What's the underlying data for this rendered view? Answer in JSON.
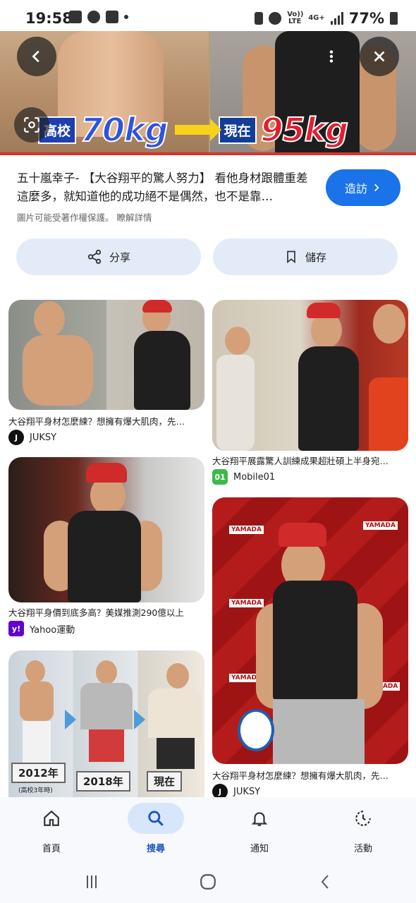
{
  "status_bar": {
    "time": "19:58",
    "volte": "Vo)) LTE",
    "network": "4G+",
    "battery": "77%"
  },
  "hero": {
    "label_left": "高校",
    "value_left": "70kg",
    "label_right": "現在",
    "value_right": "95kg"
  },
  "result": {
    "title": "五十嵐幸子- 【大谷翔平的驚人努力】 看他身材跟體重差這麼多，就知道他的成功絕不是偶然，也不是靠…",
    "visit_label": "造訪",
    "copyright": "圖片可能受著作權保護。 瞭解詳情",
    "share_label": "分享",
    "save_label": "儲存"
  },
  "related": [
    {
      "caption": "大谷翔平身材怎麼練？想擁有爆大肌肉，先…",
      "source": "JUKSY"
    },
    {
      "caption": "大谷翔平展露驚人訓練成果超壯碩上半身宛…",
      "source": "Mobile01"
    },
    {
      "caption": "大谷翔平身價到底多高？美媒推測290億以上",
      "source": "Yahoo運動"
    },
    {
      "caption": "大谷翔平身材怎麼練？想擁有爆大肌肉，先…",
      "source": "JUKSY"
    },
    {
      "caption": "",
      "source": "",
      "years": [
        "2012年",
        "2018年",
        "現在"
      ],
      "year_note": "(高校3年時)"
    }
  ],
  "bottom_nav": [
    {
      "label": "首頁",
      "icon": "home-icon"
    },
    {
      "label": "搜尋",
      "icon": "search-icon"
    },
    {
      "label": "通知",
      "icon": "bell-icon"
    },
    {
      "label": "活動",
      "icon": "activity-icon"
    }
  ],
  "colors": {
    "accent": "#1a73e8",
    "action_bg": "#e3ebf8",
    "nav_active_bg": "#d7e6fb"
  }
}
